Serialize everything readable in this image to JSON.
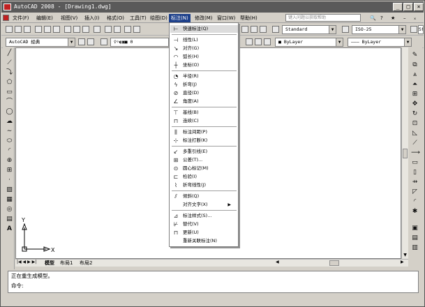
{
  "window": {
    "title": "AutoCAD 2008 - [Drawing1.dwg]",
    "buttons": [
      "_",
      "□",
      "×"
    ]
  },
  "menubar": {
    "items": [
      "文件(F)",
      "编辑(E)",
      "视图(V)",
      "插入(I)",
      "格式(O)",
      "工具(T)",
      "绘图(D)",
      "标注(N)",
      "修改(M)",
      "窗口(W)",
      "帮助(H)"
    ],
    "help_placeholder": "键入问题以获取帮助",
    "inner_buttons": [
      "–",
      "ₓ"
    ]
  },
  "toolbar": {
    "text_style": "Standard",
    "dim_style": "ISO-25",
    "third_style": "Sta"
  },
  "toolbar2": {
    "workspace": "AutoCAD 经典",
    "layer": "0",
    "color": "ByLayer",
    "linetype": "ByLayer"
  },
  "dimension_menu": {
    "items": [
      {
        "label": "快速标注(Q)",
        "icon": "quick-dim-icon"
      },
      {
        "label": "线性(L)",
        "icon": "linear-icon"
      },
      {
        "label": "对齐(G)",
        "icon": "aligned-icon"
      },
      {
        "label": "弧长(H)",
        "icon": "arc-length-icon"
      },
      {
        "label": "坐标(O)",
        "icon": "ordinate-icon"
      },
      {
        "label": "半径(R)",
        "icon": "radius-icon"
      },
      {
        "label": "折弯(J)",
        "icon": "jogged-icon"
      },
      {
        "label": "直径(D)",
        "icon": "diameter-icon"
      },
      {
        "label": "角度(A)",
        "icon": "angular-icon"
      },
      {
        "label": "基线(B)",
        "icon": "baseline-icon"
      },
      {
        "label": "连续(C)",
        "icon": "continue-icon"
      },
      {
        "label": "标注间距(P)",
        "icon": "dim-space-icon"
      },
      {
        "label": "标注打断(K)",
        "icon": "dim-break-icon"
      },
      {
        "label": "多重引线(E)",
        "icon": "multileader-icon"
      },
      {
        "label": "公差(T)...",
        "icon": "tolerance-icon"
      },
      {
        "label": "圆心标记(M)",
        "icon": "center-mark-icon"
      },
      {
        "label": "检验(I)",
        "icon": "inspection-icon"
      },
      {
        "label": "折弯线性(J)",
        "icon": "jogged-linear-icon"
      },
      {
        "label": "倾斜(Q)",
        "icon": "oblique-icon"
      },
      {
        "label": "对齐文字(X)",
        "icon": ""
      },
      {
        "label": "标注样式(S)...",
        "icon": "dim-style-icon"
      },
      {
        "label": "替代(V)",
        "icon": "override-icon"
      },
      {
        "label": "更新(U)",
        "icon": "update-icon"
      },
      {
        "label": "重新关联标注(N)",
        "icon": ""
      }
    ]
  },
  "canvas": {
    "ucs_y": "Y",
    "ucs_x": "X"
  },
  "tabs": [
    "模型",
    "布局1",
    "布局2"
  ],
  "command": {
    "line1": "正在重生成模型。",
    "line2": "命令:"
  }
}
